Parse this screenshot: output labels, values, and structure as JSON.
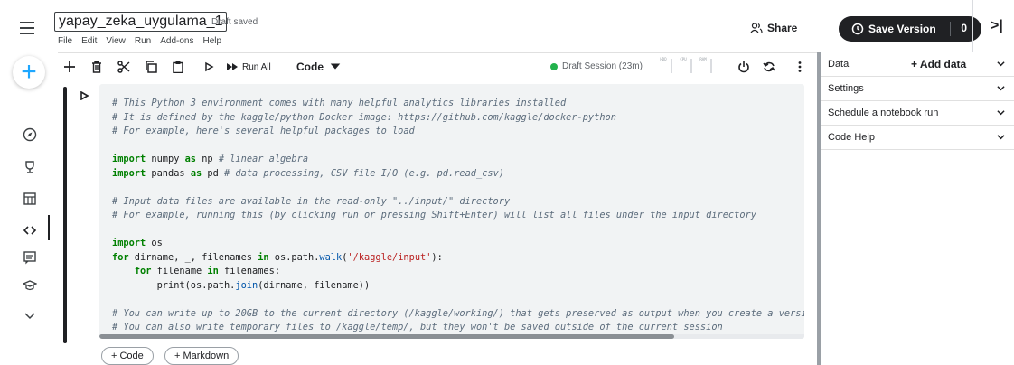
{
  "header": {
    "notebook_title": "yapay_zeka_uygulama_1",
    "draft_status": "Draft saved",
    "menu": [
      "File",
      "Edit",
      "View",
      "Run",
      "Add-ons",
      "Help"
    ],
    "share_label": "Share",
    "save_version_label": "Save Version",
    "version_count": "0",
    "collapse_label": ">|"
  },
  "toolbar": {
    "run_all_label": "Run All",
    "cell_type": "Code",
    "session_label": "Draft Session (23m)",
    "meters": [
      "HDD",
      "CPU",
      "RAM"
    ],
    "session_color": "#22b24c"
  },
  "rail": {
    "icons": [
      "menu-icon",
      "new-notebook-icon",
      "explore-icon",
      "competitions-icon",
      "datasets-icon",
      "code-icon",
      "discussions-icon",
      "learn-icon",
      "more-icon"
    ]
  },
  "right_panel": {
    "data_label": "Data",
    "add_data_label": "+ Add data",
    "sections": [
      "Settings",
      "Schedule a notebook run",
      "Code Help"
    ]
  },
  "cell": {
    "lines": [
      [
        [
          "c-com",
          "# This Python 3 environment comes with many helpful analytics libraries installed"
        ]
      ],
      [
        [
          "c-com",
          "# It is defined by the kaggle/python Docker image: https://github.com/kaggle/docker-python"
        ]
      ],
      [
        [
          "c-com",
          "# For example, here's several helpful packages to load"
        ]
      ],
      [],
      [
        [
          "c-kw",
          "import"
        ],
        [
          "",
          " numpy "
        ],
        [
          "c-kw",
          "as"
        ],
        [
          "",
          " np "
        ],
        [
          "c-com",
          "# linear algebra"
        ]
      ],
      [
        [
          "c-kw",
          "import"
        ],
        [
          "",
          " pandas "
        ],
        [
          "c-kw",
          "as"
        ],
        [
          "",
          " pd "
        ],
        [
          "c-com",
          "# data processing, CSV file I/O (e.g. pd.read_csv)"
        ]
      ],
      [],
      [
        [
          "c-com",
          "# Input data files are available in the read-only \"../input/\" directory"
        ]
      ],
      [
        [
          "c-com",
          "# For example, running this (by clicking run or pressing Shift+Enter) will list all files under the input directory"
        ]
      ],
      [],
      [
        [
          "c-kw",
          "import"
        ],
        [
          "",
          " os"
        ]
      ],
      [
        [
          "c-kw",
          "for"
        ],
        [
          "",
          " dirname, _, filenames "
        ],
        [
          "c-kw",
          "in"
        ],
        [
          "",
          " os.path."
        ],
        [
          "c-fn",
          "walk"
        ],
        [
          "",
          "("
        ],
        [
          "c-str",
          "'/kaggle/input'"
        ],
        [
          "",
          "):"
        ]
      ],
      [
        [
          "",
          "    "
        ],
        [
          "c-kw",
          "for"
        ],
        [
          "",
          " filename "
        ],
        [
          "c-kw",
          "in"
        ],
        [
          "",
          " filenames:"
        ]
      ],
      [
        [
          "",
          "        print(os.path."
        ],
        [
          "c-fn",
          "join"
        ],
        [
          "",
          "(dirname, filename))"
        ]
      ],
      [],
      [
        [
          "c-com",
          "# You can write up to 20GB to the current directory (/kaggle/working/) that gets preserved as output when you create a versi"
        ]
      ],
      [
        [
          "c-com",
          "# You can also write temporary files to /kaggle/temp/, but they won't be saved outside of the current session"
        ]
      ]
    ],
    "add_code_label": "+ Code",
    "add_markdown_label": "+ Markdown"
  }
}
